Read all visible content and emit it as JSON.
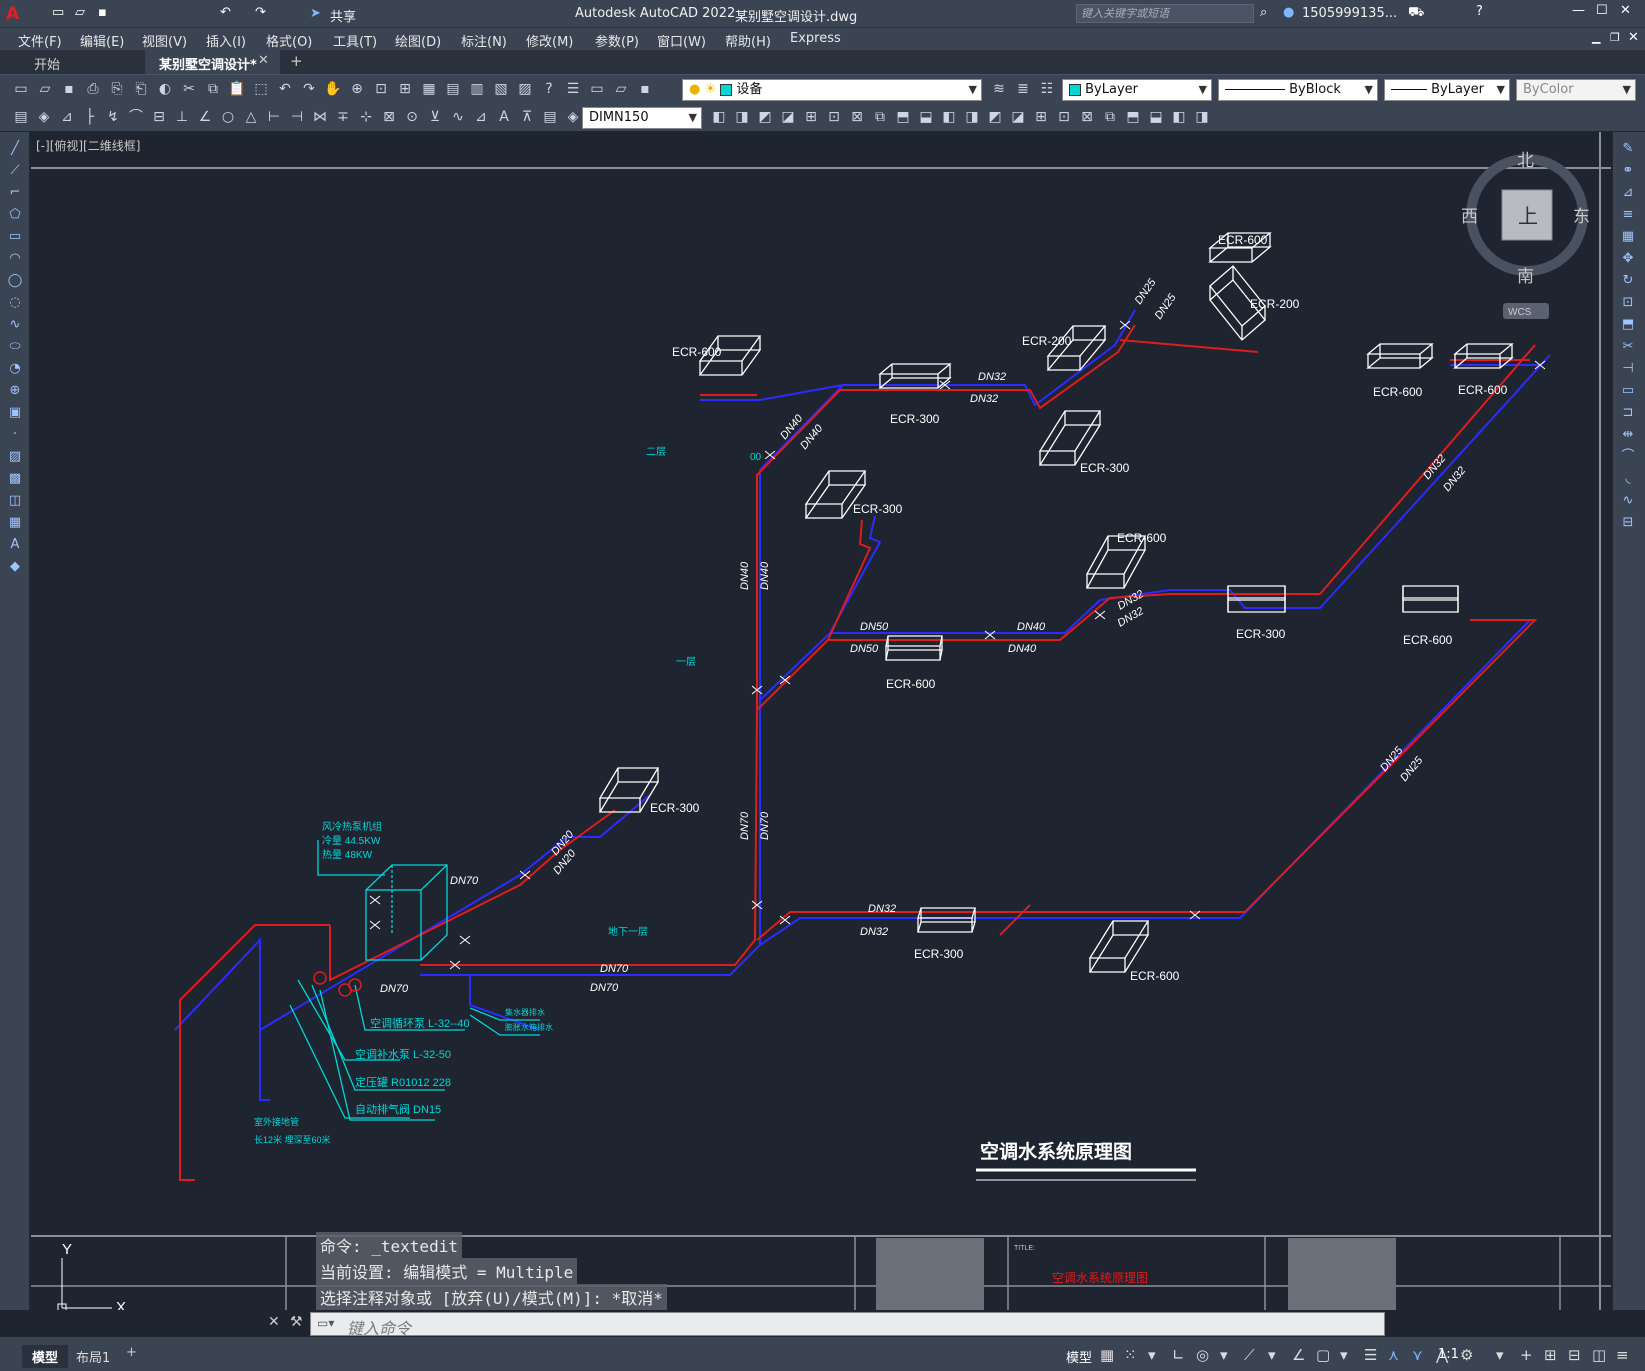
{
  "app": {
    "title": "Autodesk AutoCAD 2022",
    "file": "某别墅空调设计.dwg",
    "share": "共享",
    "search_placeholder": "键入关键字或短语",
    "user": "1505999135..."
  },
  "menu": [
    "文件(F)",
    "编辑(E)",
    "视图(V)",
    "插入(I)",
    "格式(O)",
    "工具(T)",
    "绘图(D)",
    "标注(N)",
    "修改(M)",
    "参数(P)",
    "窗口(W)",
    "帮助(H)",
    "Express"
  ],
  "tabs": [
    "开始",
    "某别墅空调设计*"
  ],
  "toolbar": {
    "layer": "设备",
    "color": "ByLayer",
    "linetype": "ByBlock",
    "lineweight": "ByLayer",
    "plotstyle": "ByColor",
    "dimstyle": "DIMN150"
  },
  "viewport": {
    "label": "[-][俯视][二维线框]"
  },
  "viewcube": {
    "north": "北",
    "south": "南",
    "east": "东",
    "west": "西",
    "top": "上",
    "wcs": "WCS"
  },
  "drawing": {
    "title": "空调水系统原理图",
    "units": [
      {
        "label": "ECR-600"
      },
      {
        "label": "ECR-200"
      },
      {
        "label": "ECR-600"
      },
      {
        "label": "ECR-300"
      },
      {
        "label": "ECR-200"
      },
      {
        "label": "ECR-300"
      },
      {
        "label": "ECR-600"
      },
      {
        "label": "ECR-600"
      },
      {
        "label": "ECR-300"
      },
      {
        "label": "ECR-600"
      },
      {
        "label": "ECR-300"
      },
      {
        "label": "ECR-600"
      },
      {
        "label": "ECR-600"
      },
      {
        "label": "ECR-300"
      },
      {
        "label": "ECR-300"
      },
      {
        "label": "ECR-600"
      }
    ],
    "pipe_labels": [
      "DN25",
      "DN25",
      "DN32",
      "DN32",
      "DN40",
      "DN40",
      "DN40",
      "DN40",
      "DN50",
      "DN50",
      "DN40",
      "DN40",
      "DN32",
      "DN32",
      "DN32",
      "DN32",
      "DN25",
      "DN25",
      "DN20",
      "DN20",
      "DN70",
      "DN70",
      "DN70",
      "DN70",
      "DN70",
      "DN70",
      "DN32",
      "DN32"
    ],
    "floor_labels": [
      "二层",
      "一层",
      "地下一层"
    ],
    "equipment": {
      "l1": "风冷热泵机组",
      "l2": "冷量 44.5KW",
      "l3": "热量 48KW"
    },
    "notes": [
      "空调循环泵  L-32--40",
      "空调补水泵  L-32-50",
      "定压罐  R01012  228",
      "自动排气阀 DN15",
      "集水器排水",
      "膨胀水箱排水",
      "室外接地管",
      "长12米 埋深至60米"
    ],
    "titleblock": {
      "title_label": "TITLE:",
      "title": "空调水系统原理图"
    }
  },
  "command": {
    "line1": "命令: _textedit",
    "line2": "当前设置: 编辑模式 = Multiple",
    "line3": "选择注释对象或 [放弃(U)/模式(M)]: *取消*",
    "placeholder": "键入命令"
  },
  "status": {
    "tabs": [
      "模型",
      "布局1"
    ],
    "model": "模型",
    "scale": "1:1"
  },
  "colors": {
    "supply": "#e01c1c",
    "return": "#2c2cff",
    "equipment": "#00d8d8",
    "text": "#ffffff"
  }
}
